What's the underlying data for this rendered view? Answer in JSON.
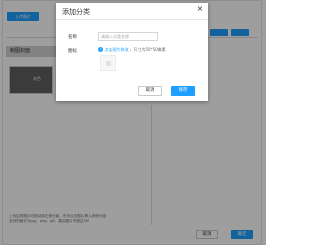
{
  "background": {
    "upload_button_label": "上传图片",
    "sidebar_header": "制图封面",
    "thumbnail_label": "灰色",
    "footnotes": [
      "上传后的图片可拖动到左侧分组，也可点击图片移入其他分组",
      "支持的格式为jpg、png、gif，建议图片不超过2M"
    ],
    "footer_cancel_label": "取消",
    "footer_confirm_label": "确定"
  },
  "dialog": {
    "title": "添加分类",
    "close_glyph": "×",
    "name_label": "名称",
    "name_value": "",
    "name_placeholder": "请输入分类名称",
    "icon_label": "图标",
    "info_glyph": "i",
    "upload_link": "点击图片修改",
    "upload_hint": "，尺寸为50*50像素",
    "cancel_label": "取消",
    "confirm_label": "保存"
  },
  "colors": {
    "accent": "#1e9fff",
    "overlay": "rgba(0,0,0,0.38)"
  }
}
